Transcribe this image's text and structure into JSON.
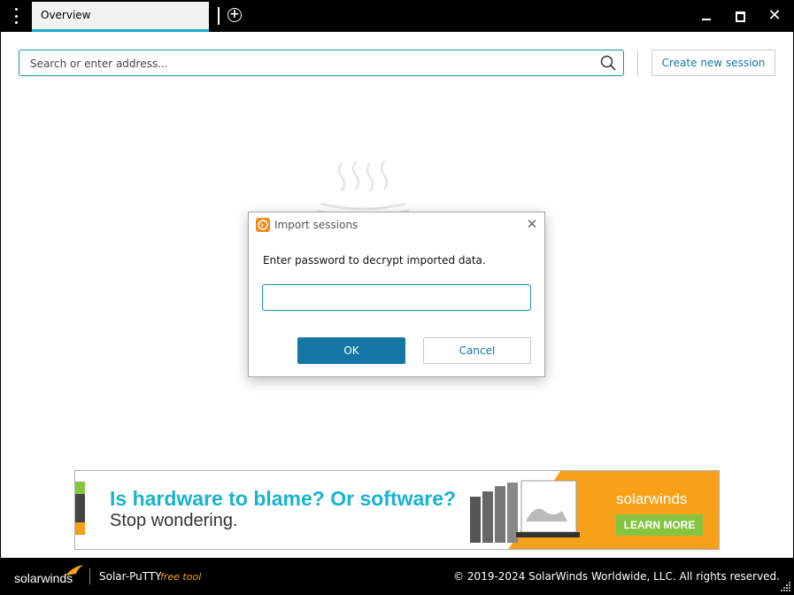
{
  "titlebar": {
    "menu_icon": "vertical-dots-icon",
    "tab_label": "Overview",
    "new_tab_icon": "plus-circle-icon",
    "controls": [
      "minimize-icon",
      "maximize-icon",
      "close-icon"
    ],
    "accent_color": "#1aa9c7"
  },
  "toolbar": {
    "search_placeholder": "Search or enter address...",
    "search_icon": "search-icon",
    "create_label": "Create new session"
  },
  "dialog": {
    "title": "Import sessions",
    "message": "Enter password to decrypt imported data.",
    "password_value": "",
    "ok_label": "OK",
    "cancel_label": "Cancel",
    "primary_color": "#1576a6"
  },
  "banner": {
    "headline": "Is hardware to blame? Or software?",
    "subline": "Stop wondering.",
    "brand": "solarwinds",
    "cta": "LEARN MORE",
    "colors": {
      "headline": "#1ab3cf",
      "orange": "#f7a119",
      "cta": "#84c441"
    }
  },
  "footer": {
    "brand": "solarwinds",
    "product": "Solar-PuTTY",
    "product_tag": "free tool",
    "copyright": "© 2019-2024 SolarWinds Worldwide, LLC. All rights reserved."
  }
}
